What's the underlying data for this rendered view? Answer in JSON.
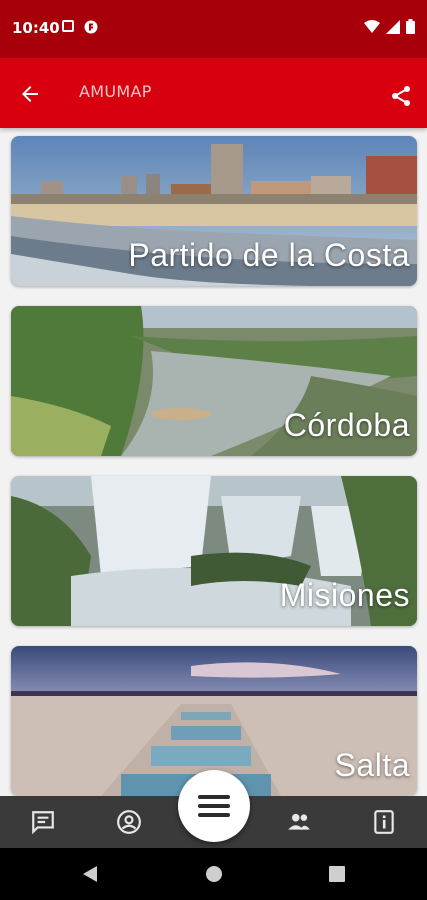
{
  "status_bar": {
    "time": "10:40",
    "icons": [
      "notification-square-icon",
      "app-notification-icon",
      "wifi-icon",
      "signal-icon",
      "battery-icon"
    ]
  },
  "app_bar": {
    "title": "AMUMAP",
    "back_icon": "arrow-back-icon",
    "share_icon": "share-icon",
    "color": "#d8000e",
    "status_color": "#a8000b"
  },
  "cards": [
    {
      "label": "Partido de la Costa"
    },
    {
      "label": "Córdoba"
    },
    {
      "label": "Misiones"
    },
    {
      "label": "Salta"
    }
  ],
  "bottom_nav": {
    "items": [
      {
        "icon": "chat-icon"
      },
      {
        "icon": "account-circle-icon"
      },
      {
        "icon": "menu-icon"
      },
      {
        "icon": "group-icon"
      },
      {
        "icon": "info-icon"
      }
    ],
    "color": "#3a3a3a"
  },
  "system_nav": {
    "icons": [
      "back-triangle-icon",
      "home-circle-icon",
      "recents-square-icon"
    ]
  }
}
